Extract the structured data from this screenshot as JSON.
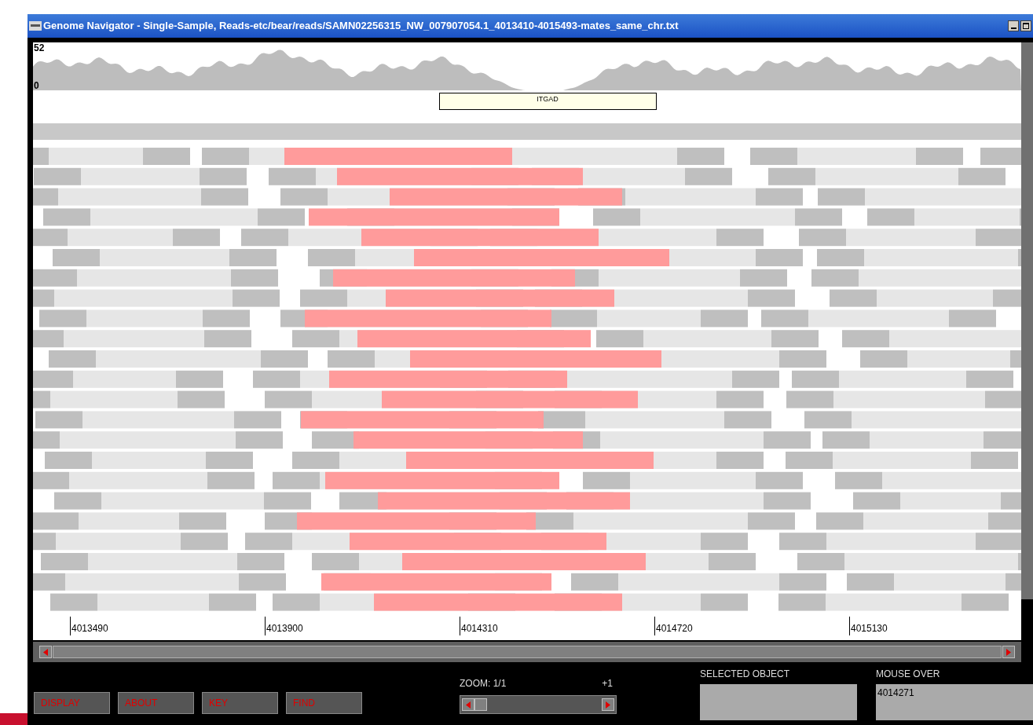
{
  "window": {
    "title": "Genome Navigator - Single-Sample, Reads-etc/bear/reads/SAMN02256315_NW_007907054.1_4013410-4015493-mates_same_chr.txt"
  },
  "coverage": {
    "max_label": "52",
    "min_label": "0"
  },
  "genes": [
    {
      "name": "ITGAD"
    }
  ],
  "ruler": {
    "ticks": [
      "4013490",
      "4013900",
      "4014310",
      "4014720",
      "4015130"
    ]
  },
  "controls": {
    "buttons": [
      "DISPLAY",
      "ABOUT",
      "KEY",
      "FIND"
    ],
    "zoom": {
      "label": "ZOOM: 1/1",
      "step": "+1"
    },
    "selected_object": {
      "label": "SELECTED OBJECT"
    },
    "mouse_over": {
      "label": "MOUSE OVER",
      "value": "4014271"
    }
  }
}
